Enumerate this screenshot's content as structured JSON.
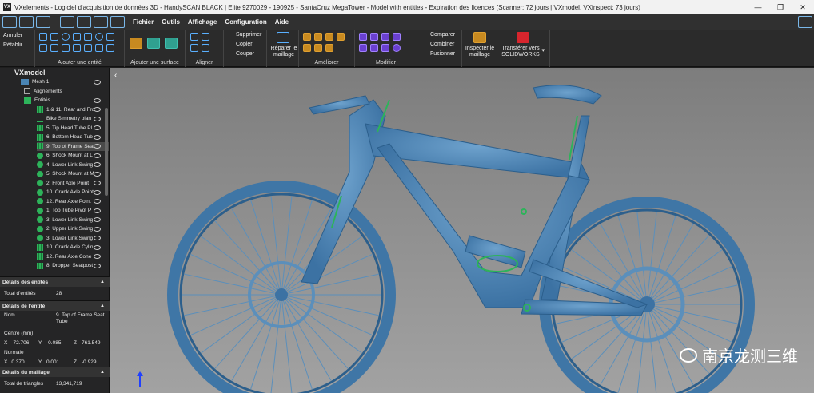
{
  "title": "VXelements - Logiciel d'acquisition de données 3D - HandySCAN BLACK | Elite 9270029 - 190925 - SantaCruz MegaTower - Model with entities - Expiration des licences (Scanner: 72 jours | VXmodel, VXinspect: 73 jours)",
  "logo": "VX",
  "menu": [
    "Fichier",
    "Outils",
    "Affichage",
    "Configuration",
    "Aide"
  ],
  "ribbon": {
    "undo": "Annuler",
    "redo": "Rétablir",
    "group_add_entity": "Ajouter une entité",
    "group_add_surface": "Ajouter une surface",
    "group_align": "Aligner",
    "delete": "Supprimer",
    "copy": "Copier",
    "cut": "Couper",
    "repair": "Réparer le maillage",
    "group_improve": "Améliorer",
    "group_modify": "Modifier",
    "compare": "Comparer",
    "combine": "Combiner",
    "merge": "Fusionner",
    "inspect": "Inspecter le maillage",
    "transfer": "Transférer vers SOLIDWORKS"
  },
  "tree": {
    "root": "VXmodel",
    "mesh": "Mesh 1",
    "alignments": "Alignements",
    "entities": "Entités",
    "items": [
      "1 & 11. Rear and Fro",
      "Bike Simmetry plan",
      "5. Tip Head Tube Pl",
      "6. Bottom Head Tub",
      "9. Top of Frame Seat",
      "6. Shock Mount at L",
      "4. Lower Link Swing",
      "5. Shock Mount at M",
      "2. Front Axle Point",
      "10. Crank Axle Point",
      "12. Rear Axle Point",
      "1. Top Tube Pivot P",
      "3. Lower Link Swing",
      "2. Upper Link Swing",
      "3. Lower Link Swing",
      "10. Crank Axle Cylin",
      "12. Rear Axle Cone",
      "8. Dropper Seatpost"
    ]
  },
  "details_entities": {
    "header": "Détails des entités",
    "label": "Total d'entités",
    "value": "28"
  },
  "details_entity": {
    "header": "Détails de l'entité",
    "name_label": "Nom",
    "name_value": "9. Top of Frame Seat Tube",
    "center_label": "Centre (mm)",
    "cx": "-72.706",
    "cy": "-0.085",
    "cz": "761.549",
    "normal_label": "Normale",
    "nx": "0.370",
    "ny": "0.001",
    "nz": "-0.929",
    "x": "X",
    "y": "Y",
    "z": "Z"
  },
  "details_mesh": {
    "header": "Détails du maillage",
    "tri_label": "Total de triangles",
    "tri_value": "13,341,719"
  },
  "watermark": "南京龙测三维",
  "colors": {
    "bike": "#4a85b5",
    "accent": "#2db35a",
    "ribbon_icon": "#5ab0ff"
  }
}
